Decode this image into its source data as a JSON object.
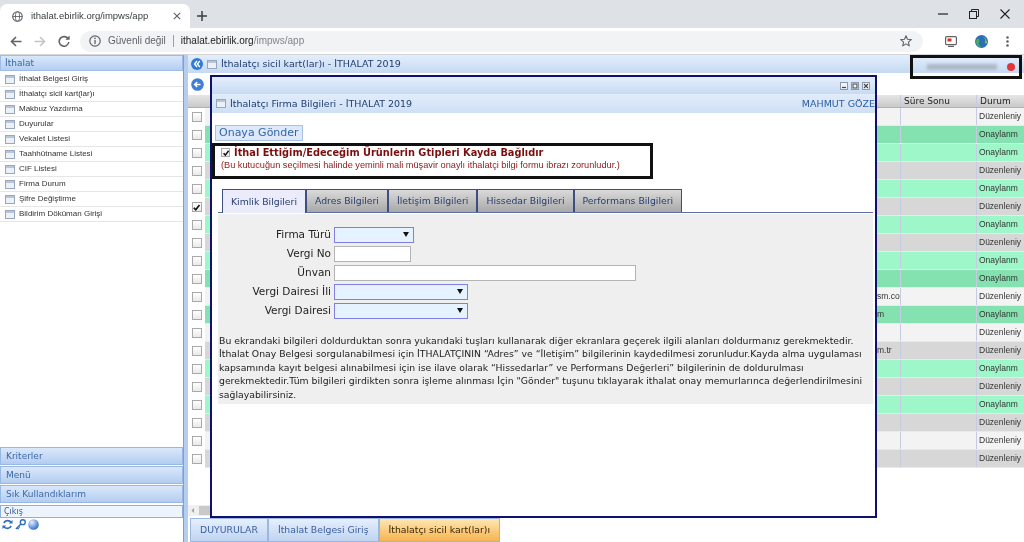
{
  "browser": {
    "tab_title": "ithalat.ebirlik.org/impws/app",
    "security_label": "Güvenli değil",
    "url_host": "ithalat.ebirlik.org",
    "url_path": "/impws/app",
    "forward_disabled": true
  },
  "sidebar": {
    "title": "İthalat",
    "items": [
      {
        "label": "İthalat Belgesi Giriş"
      },
      {
        "label": "İthalatçı sicil kart(lar)ı"
      },
      {
        "label": "Makbuz Yazdırma"
      },
      {
        "label": "Duyurular"
      },
      {
        "label": "Vekalet Listesi"
      },
      {
        "label": "Taahhütname Listesi"
      },
      {
        "label": "CIF Listesi"
      },
      {
        "label": "Firma Durum"
      },
      {
        "label": "Şifre Değiştirme"
      },
      {
        "label": "Bildirim Döküman Girişi"
      }
    ],
    "panels": [
      "Kriterler",
      "Menü",
      "Sık Kullandıklarım"
    ],
    "logout": "Çıkış"
  },
  "main": {
    "title": "İthalatçı sicil kart(lar)ı - İTHALAT 2019"
  },
  "table": {
    "columns": [
      "Süre Sonu",
      "Durum"
    ],
    "rows": [
      {
        "checked": false,
        "color": "#f3f3f3",
        "status": "Düzenleniy"
      },
      {
        "checked": false,
        "color": "#84e2b0",
        "status": "Onaylanm"
      },
      {
        "checked": false,
        "color": "#9ef7c8",
        "status": "Onaylanm"
      },
      {
        "checked": false,
        "color": "#d7d7d7",
        "status": "Düzenleniy"
      },
      {
        "checked": false,
        "color": "#9ef7c8",
        "status": "Onaylanm"
      },
      {
        "checked": true,
        "color": "#d7d7d7",
        "status": "Düzenleniy"
      },
      {
        "checked": false,
        "color": "#9ef7c8",
        "status": "Onaylanm"
      },
      {
        "checked": false,
        "color": "#d7d7d7",
        "status": "Düzenleniy"
      },
      {
        "checked": false,
        "color": "#9ef7c8",
        "status": "Onaylanm"
      },
      {
        "checked": false,
        "color": "#84e2b0",
        "status": "Onaylanm"
      },
      {
        "checked": false,
        "color": "#f3f3f3",
        "column_1": "sm.co",
        "status": "Düzenleniy"
      },
      {
        "checked": false,
        "color": "#84e2b0",
        "column_1": "m",
        "status": "Onaylanm"
      },
      {
        "checked": false,
        "color": "#f3f3f3",
        "status": "Düzenleniy"
      },
      {
        "checked": false,
        "color": "#d7d7d7",
        "column_1": "m.tr",
        "status": "Düzenleniy"
      },
      {
        "checked": false,
        "color": "#9ef7c8",
        "status": "Onaylanm"
      },
      {
        "checked": false,
        "color": "#d7d7d7",
        "status": "Düzenleniy"
      },
      {
        "checked": false,
        "color": "#9ef7c8",
        "status": "Onaylanm"
      },
      {
        "checked": false,
        "color": "#d7d7d7",
        "status": "Düzenleniy"
      },
      {
        "checked": false,
        "color": "#f3f3f3",
        "status": "Düzenleniy"
      },
      {
        "checked": false,
        "color": "#d7d7d7",
        "status": "Düzenleniy"
      }
    ]
  },
  "dialog": {
    "title": "İthalatçı Firma Bilgileri - İTHALAT 2019",
    "user": "MAHMUT GÖZE",
    "submit_button": "Onaya Gönder",
    "notice": {
      "checked": true,
      "title": "İthal Ettiğim/Edeceğim Ürünlerin Gtipleri Kayda Bağlıdır",
      "note": "(Bu kutucuğun seçilmesi halinde yeminli mali müşavir onaylı ithalatçi bilgi formu ibrazı zorunludur.)"
    },
    "tabs": [
      {
        "label": "Kimlik Bilgileri",
        "selected": true
      },
      {
        "label": "Adres Bilgileri",
        "selected": false
      },
      {
        "label": "İletişim Bilgileri",
        "selected": false
      },
      {
        "label": "Hissedar Bilgileri",
        "selected": false
      },
      {
        "label": "Performans Bilgileri",
        "selected": false
      }
    ],
    "fields": [
      {
        "label": "Firma Türü",
        "kind": "select"
      },
      {
        "label": "Vergi No",
        "kind": "text"
      },
      {
        "label": "Ünvan",
        "kind": "text"
      },
      {
        "label": "Vergi Dairesi İli",
        "kind": "select"
      },
      {
        "label": "Vergi Dairesi",
        "kind": "select"
      }
    ],
    "help_text": "Bu ekrandaki bilgileri doldurduktan sonra yukarıdaki tuşları kullanarak diğer ekranlara geçerek ilgili alanları doldurmanız gerekmektedir. İthalat Onay Belgesi sorgulanabilmesi için İTHALATÇININ “Adres” ve “İletişim” bilgilerinin kaydedilmesi zorunludur.Kayda alma uygulaması kapsamında kayıt belgesi alınabilmesi için ise ilave olarak “Hissedarlar” ve Performans Değerleri” bilgilerinin de doldurulması gerekmektedir.Tüm bilgileri girdikten sonra işleme alınması İçin \"Gönder\" tuşunu tıklayarak ithalat onay memurlarınca değerlendirilmesini sağlayabilirsiniz."
  },
  "bottom_tabs": [
    {
      "label": "DUYURULAR",
      "selected": false
    },
    {
      "label": "İthalat Belgesi Giriş",
      "selected": false
    },
    {
      "label": "İthalatçı sicil kart(lar)ı",
      "selected": true
    }
  ]
}
